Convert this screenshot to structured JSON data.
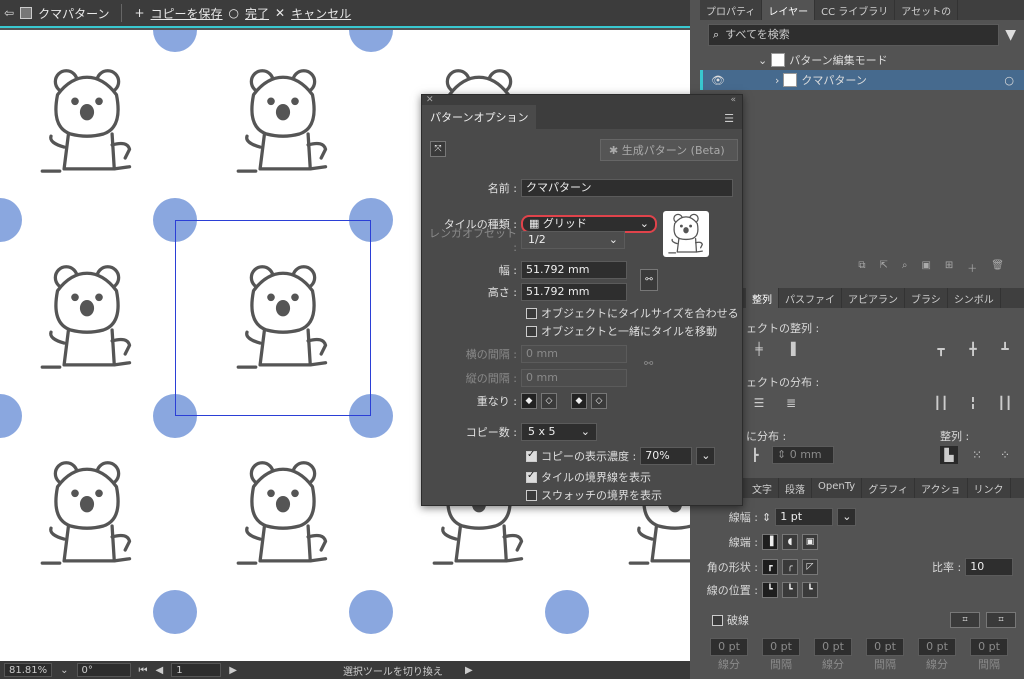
{
  "editbar": {
    "pattern_name": "クマパターン",
    "save_copy": "コピーを保存",
    "done": "完了",
    "cancel": "キャンセル"
  },
  "right_tabs_top": [
    "プロパティ",
    "レイヤー",
    "CC ライブラリ",
    "アセットの"
  ],
  "layers": {
    "search_placeholder": "すべてを検索",
    "items": [
      {
        "label": "パターン編集モード"
      },
      {
        "label": "クマパターン"
      }
    ]
  },
  "align_tabs": [
    "整列",
    "パスファイ",
    "アピアラン",
    "ブラシ",
    "シンボル"
  ],
  "align": {
    "object_align": "ェクトの整列 :",
    "object_distribute": "ェクトの分布 :",
    "spacing_label": "に分布 :",
    "align_to": "整列 :",
    "spacing_value": "0 mm"
  },
  "stroke_tabs": [
    "文字",
    "段落",
    "OpenTy",
    "グラフィ",
    "アクショ",
    "リンク"
  ],
  "stroke": {
    "weight_label": "線幅 :",
    "weight_value": "1 pt",
    "cap_label": "線端 :",
    "corner_label": "角の形状 :",
    "ratio_label": "比率 :",
    "ratio_value": "10",
    "position_label": "線の位置 :",
    "dashed_label": "破線",
    "dash_fields": [
      "0 pt",
      "0 pt",
      "0 pt",
      "0 pt",
      "0 pt",
      "0 pt"
    ],
    "dash_labels": [
      "線分",
      "間隔",
      "線分",
      "間隔",
      "線分",
      "間隔"
    ]
  },
  "dialog": {
    "tab": "パターンオプション",
    "generate_button": "生成パターン (Beta)",
    "name_label": "名前 :",
    "name_value": "クマパターン",
    "tile_type_label": "タイルの種類 :",
    "tile_type_value": "グリッド",
    "brick_offset_label": "レンガオフセット :",
    "brick_offset_value": "1/2",
    "width_label": "幅 :",
    "width_value": "51.792 mm",
    "height_label": "高さ :",
    "height_value": "51.792 mm",
    "fit_tile": "オブジェクトにタイルサイズを合わせる",
    "move_tile": "オブジェクトと一緒にタイルを移動",
    "h_spacing_label": "横の間隔 :",
    "h_spacing_value": "0 mm",
    "v_spacing_label": "縦の間隔 :",
    "v_spacing_value": "0 mm",
    "overlap_label": "重なり :",
    "copies_label": "コピー数 :",
    "copies_value": "5 x 5",
    "dim_copies": "コピーの表示濃度 :",
    "dim_value": "70%",
    "show_tile_edge": "タイルの境界線を表示",
    "show_swatch_bounds": "スウォッチの境界を表示"
  },
  "statusbar": {
    "zoom": "81.81%",
    "rotation": "0°",
    "artboard": "1",
    "tool_hint": "選択ツールを切り換え"
  },
  "colors": {
    "dot": "#8aa7df",
    "tile_outline": "#2b3fd6",
    "accent_line": "#39c8d0",
    "highlight": "#e0434b"
  }
}
